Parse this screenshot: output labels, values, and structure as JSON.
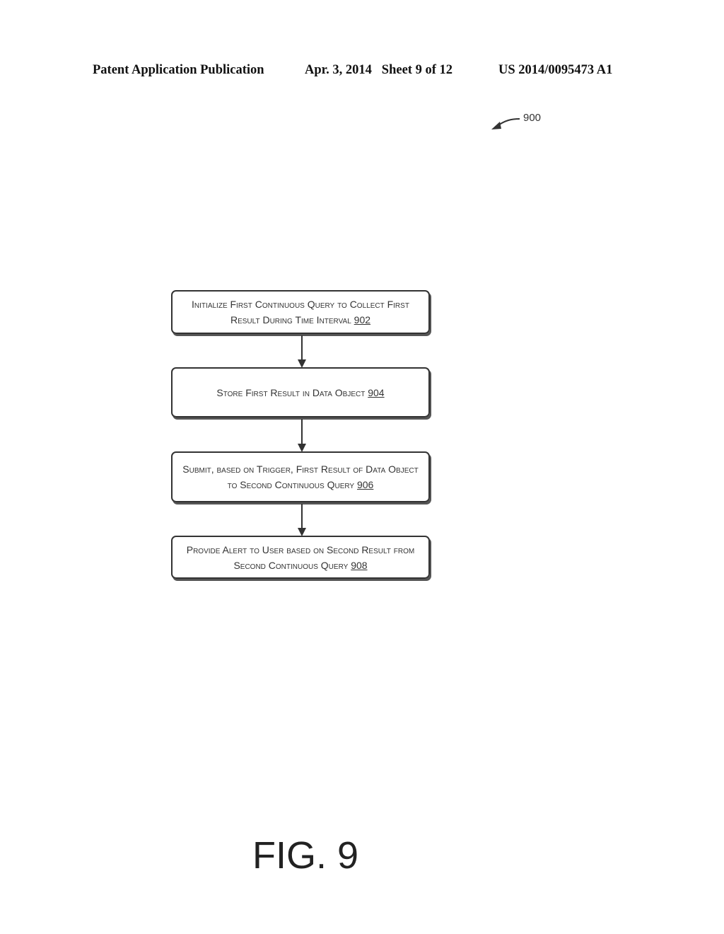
{
  "header": {
    "left": "Patent Application Publication",
    "middle": "Apr. 3, 2014   Sheet 9 of 12",
    "right": "US 2014/0095473 A1"
  },
  "figure_ref": "900",
  "steps": [
    {
      "text": "Initialize First Continuous Query to Collect First Result During Time Interval",
      "num": "902"
    },
    {
      "text": "Store First Result in Data Object",
      "num": "904"
    },
    {
      "text": "Submit, based on Trigger, First Result of Data Object to Second Continuous Query",
      "num": "906"
    },
    {
      "text": "Provide Alert to User based on Second Result from Second Continuous Query",
      "num": "908"
    }
  ],
  "figure_label": "FIG. 9"
}
